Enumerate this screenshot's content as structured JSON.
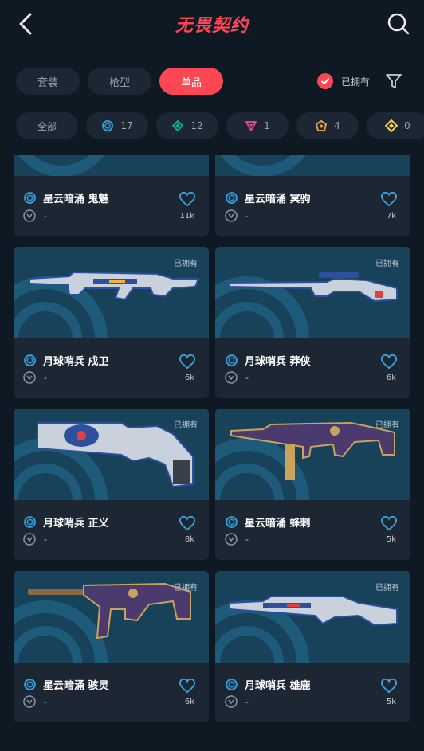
{
  "header": {
    "title": "无畏契约",
    "back_icon": "chevron-left-icon",
    "search_icon": "search-icon"
  },
  "tabs": [
    {
      "label": "套装",
      "active": false
    },
    {
      "label": "枪型",
      "active": false
    },
    {
      "label": "单品",
      "active": true
    }
  ],
  "owned_filter": {
    "label": "已拥有",
    "checked": true
  },
  "filter_icon": "funnel-icon",
  "tiers": [
    {
      "label": "全部",
      "icon": null
    },
    {
      "label": "17",
      "icon": "select-tier-icon",
      "color": "#2f9bd9"
    },
    {
      "label": "12",
      "icon": "deluxe-tier-icon",
      "color": "#1ba48a"
    },
    {
      "label": "1",
      "icon": "premium-tier-icon",
      "color": "#d14c8e"
    },
    {
      "label": "4",
      "icon": "exclusive-tier-icon",
      "color": "#e59b4c"
    },
    {
      "label": "0",
      "icon": "ultra-tier-icon",
      "color": "#f1d35c"
    }
  ],
  "skins": [
    {
      "name": "星云暗涌 鬼魅",
      "variant": "-",
      "likes": "11k",
      "owned": false
    },
    {
      "name": "星云暗涌 冥驹",
      "variant": "-",
      "likes": "7k",
      "owned": false
    },
    {
      "name": "月球哨兵 戍卫",
      "variant": "-",
      "likes": "6k",
      "owned": true,
      "owned_label": "已拥有"
    },
    {
      "name": "月球哨兵 莽侠",
      "variant": "-",
      "likes": "6k",
      "owned": true,
      "owned_label": "已拥有"
    },
    {
      "name": "月球哨兵 正义",
      "variant": "-",
      "likes": "8k",
      "owned": true,
      "owned_label": "已拥有"
    },
    {
      "name": "星云暗涌 蜂刺",
      "variant": "-",
      "likes": "5k",
      "owned": true,
      "owned_label": "已拥有"
    },
    {
      "name": "星云暗涌 骇灵",
      "variant": "-",
      "likes": "6k",
      "owned": true,
      "owned_label": "已拥有"
    },
    {
      "name": "月球哨兵 雄鹿",
      "variant": "-",
      "likes": "5k",
      "owned": true,
      "owned_label": "已拥有"
    }
  ],
  "colors": {
    "accent": "#ff4655",
    "background": "#0f1923",
    "card": "#1c2733",
    "heart": "#3ba3e0"
  }
}
